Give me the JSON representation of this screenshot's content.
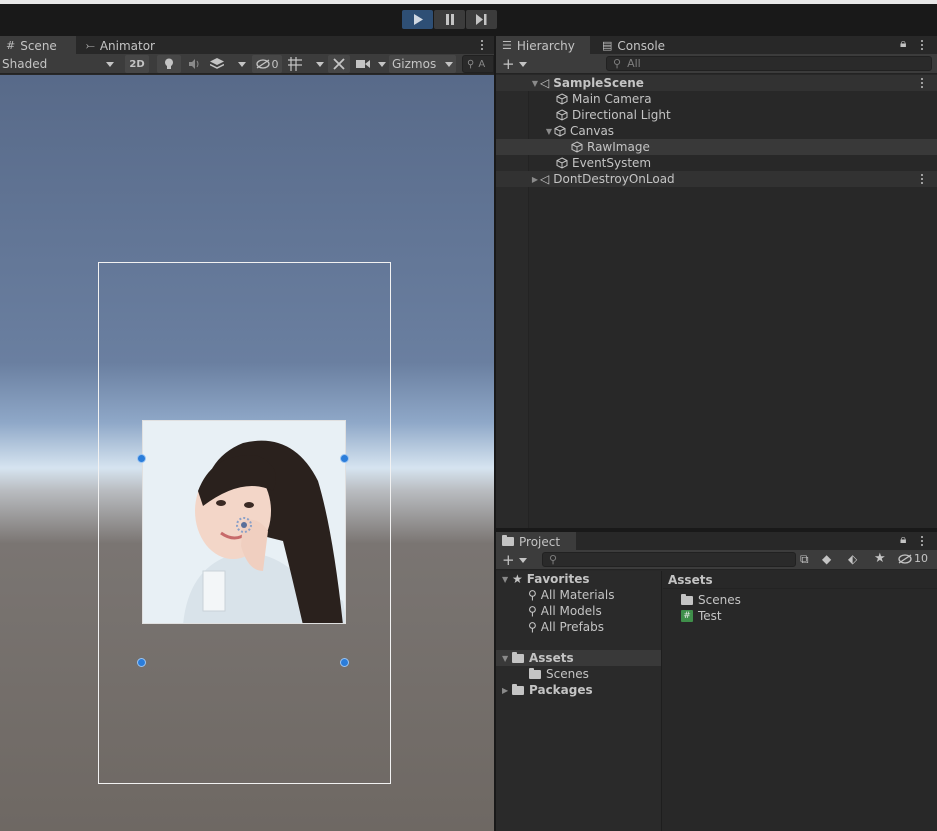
{
  "topbar": {
    "play": "play",
    "pause": "pause",
    "step": "step"
  },
  "scene": {
    "tabs": [
      {
        "label": "Scene",
        "icon": "grid-icon"
      },
      {
        "label": "Animator",
        "icon": "animator-icon"
      }
    ],
    "toolbar": {
      "shading_mode": "Shaded",
      "mode_2d": "2D",
      "hidden_count": "0",
      "gizmos": "Gizmos",
      "search_placeholder": "A"
    }
  },
  "hierarchy": {
    "tabs": [
      {
        "label": "Hierarchy"
      },
      {
        "label": "Console"
      }
    ],
    "search_placeholder": "All",
    "items": [
      {
        "label": "SampleScene",
        "type": "scene"
      },
      {
        "label": "Main Camera",
        "type": "object"
      },
      {
        "label": "Directional Light",
        "type": "object"
      },
      {
        "label": "Canvas",
        "type": "object"
      },
      {
        "label": "RawImage",
        "type": "object"
      },
      {
        "label": "EventSystem",
        "type": "object"
      },
      {
        "label": "DontDestroyOnLoad",
        "type": "scene"
      }
    ]
  },
  "project": {
    "tab": "Project",
    "hidden_count": "10",
    "tree": [
      {
        "label": "Favorites"
      },
      {
        "label": "All Materials"
      },
      {
        "label": "All Models"
      },
      {
        "label": "All Prefabs"
      },
      {
        "label": "Assets"
      },
      {
        "label": "Scenes"
      },
      {
        "label": "Packages"
      }
    ],
    "content_header": "Assets",
    "content": [
      {
        "label": "Scenes",
        "icon": "folder-icon"
      },
      {
        "label": "Test",
        "icon": "script-icon"
      }
    ]
  },
  "colors": {
    "play_active": "#2e4f75",
    "handle": "#2b7dda",
    "script": "#3f8f4a"
  }
}
